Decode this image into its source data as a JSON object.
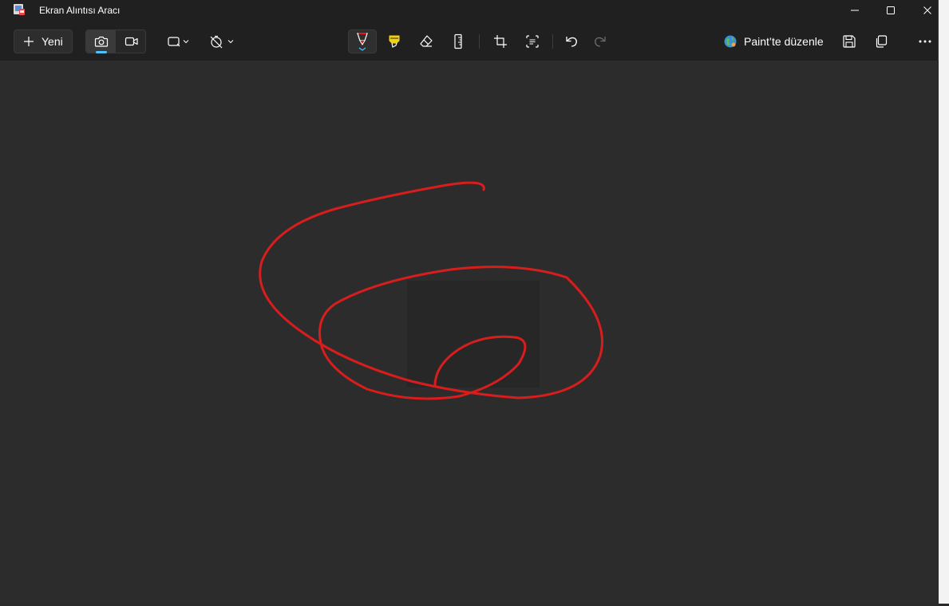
{
  "window": {
    "title": "Ekran Alıntısı Aracı"
  },
  "titlebar_buttons": {
    "minimize": "minimize-icon",
    "maximize": "maximize-icon",
    "close": "close-icon"
  },
  "toolbar": {
    "new_label": "Yeni",
    "paint_label": "Paint’te düzenle",
    "accent_color": "#4cc2ff",
    "pen_color": "#e01b1b",
    "highlighter_color": "#f2d20b",
    "icons": {
      "new": "plus-icon",
      "snapshot_mode": "camera-icon",
      "video_mode": "video-camera-icon",
      "snip_shape": "rectangle-snip-icon",
      "timer": "timer-off-icon",
      "pen": "ballpoint-pen-icon",
      "highlighter": "highlighter-icon",
      "eraser": "eraser-icon",
      "ruler": "ruler-icon",
      "crop": "crop-icon",
      "text_actions": "text-actions-icon",
      "undo": "undo-icon",
      "redo": "redo-icon",
      "paint": "paint-globe-icon",
      "save": "save-icon",
      "copy": "copy-icon",
      "more": "more-options-icon"
    }
  },
  "canvas": {
    "background": "#2c2c2c",
    "ink_color": "#d81d1d"
  }
}
